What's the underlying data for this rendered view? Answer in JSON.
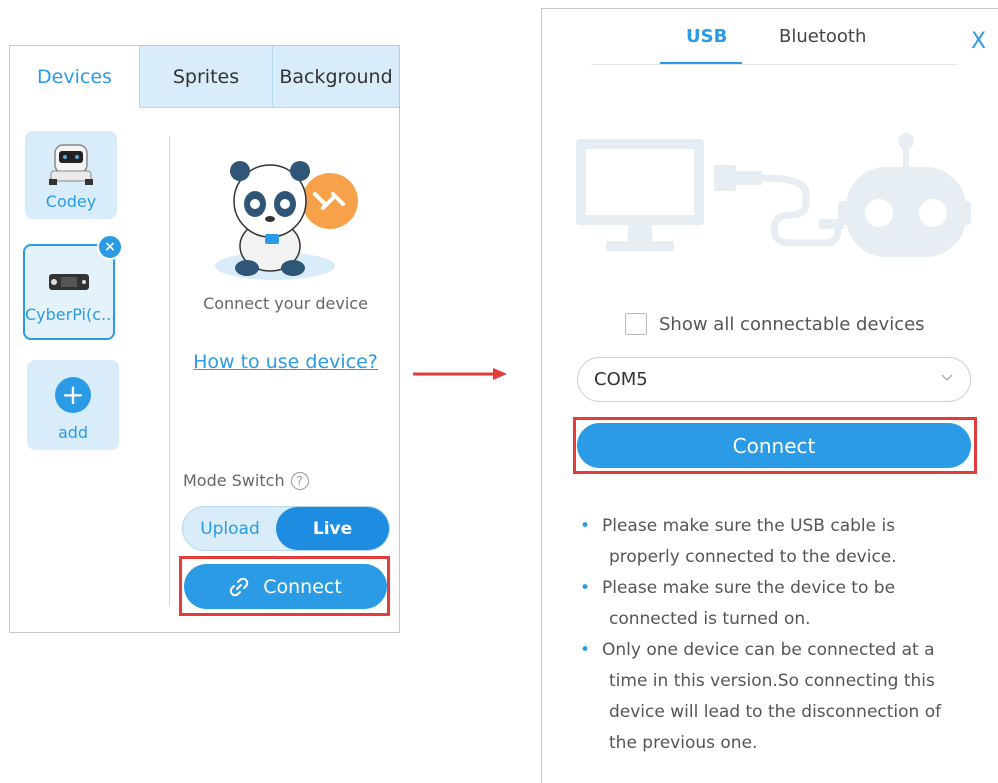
{
  "left_panel": {
    "tabs": [
      "Devices",
      "Sprites",
      "Background"
    ],
    "devices": [
      {
        "label": "Codey"
      },
      {
        "label": "CyberPi(c..."
      },
      {
        "label": "add"
      }
    ],
    "remove_icon": "×",
    "connect_prompt": "Connect your device",
    "howto_link": "How to use device?",
    "mode_switch_label": "Mode Switch",
    "help_icon": "?",
    "mode_upload": "Upload",
    "mode_live": "Live",
    "connect_button": "Connect",
    "colors": {
      "accent": "#2b9be6",
      "tab_bg": "#d8ecf9",
      "highlight": "#e43b3b"
    }
  },
  "right_panel": {
    "tabs": [
      "USB",
      "Bluetooth"
    ],
    "close_icon": "X",
    "show_all_label": "Show all connectable devices",
    "port_value": "COM5",
    "connect_button": "Connect",
    "notes": [
      [
        "Please make sure the USB cable is",
        "properly connected to the device."
      ],
      [
        "Please make sure the device to be",
        "connected is turned on."
      ],
      [
        "Only one device can be connected at a",
        "time in this version.So connecting this",
        "device will lead to the disconnection of",
        "the previous one."
      ]
    ]
  }
}
